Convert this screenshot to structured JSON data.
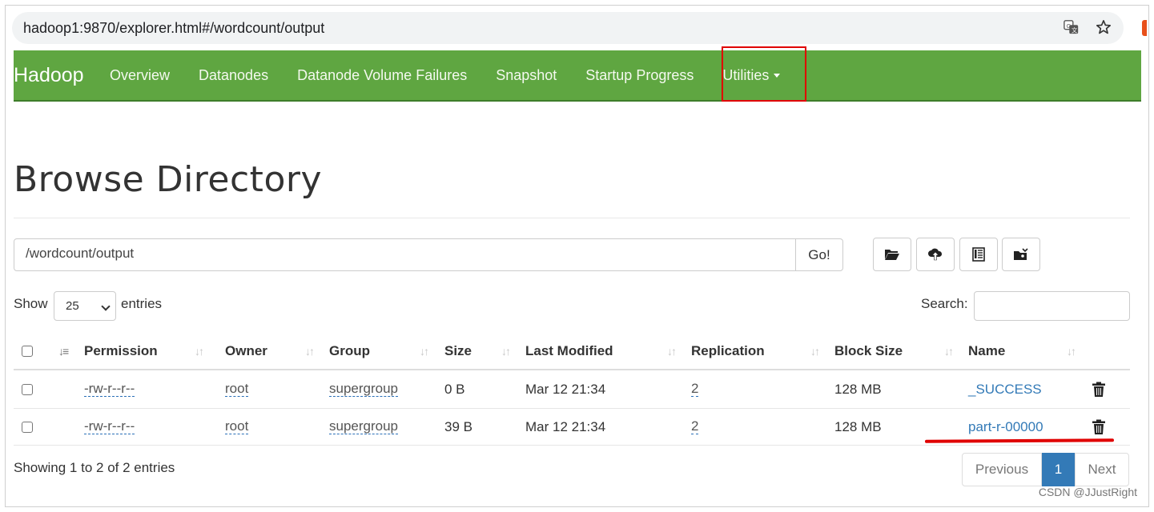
{
  "browser": {
    "url": "hadoop1:9870/explorer.html#/wordcount/output",
    "icons": [
      "translate-icon",
      "star-icon"
    ]
  },
  "navbar": {
    "brand": "Hadoop",
    "items": [
      "Overview",
      "Datanodes",
      "Datanode Volume Failures",
      "Snapshot",
      "Startup Progress",
      "Utilities"
    ],
    "color": "#5fa641"
  },
  "page": {
    "title": "Browse Directory",
    "path_value": "/wordcount/output",
    "go_label": "Go!",
    "tools": [
      "folder-open-icon",
      "upload-cloud-icon",
      "list-icon",
      "cut-paste-icon"
    ]
  },
  "controls": {
    "show_label": "Show",
    "entries_value": "25",
    "entries_label": "entries",
    "search_label": "Search:"
  },
  "table": {
    "headers": [
      "Permission",
      "Owner",
      "Group",
      "Size",
      "Last Modified",
      "Replication",
      "Block Size",
      "Name"
    ],
    "rows": [
      {
        "permission": "-rw-r--r--",
        "owner": "root",
        "group": "supergroup",
        "size": "0 B",
        "modified": "Mar 12 21:34",
        "replication": "2",
        "block_size": "128 MB",
        "name": "_SUCCESS"
      },
      {
        "permission": "-rw-r--r--",
        "owner": "root",
        "group": "supergroup",
        "size": "39 B",
        "modified": "Mar 12 21:34",
        "replication": "2",
        "block_size": "128 MB",
        "name": "part-r-00000"
      }
    ]
  },
  "footer": {
    "info": "Showing 1 to 2 of 2 entries",
    "prev": "Previous",
    "current": "1",
    "next": "Next"
  },
  "watermark": "CSDN @JJustRight",
  "annotation_color": "#e00000"
}
